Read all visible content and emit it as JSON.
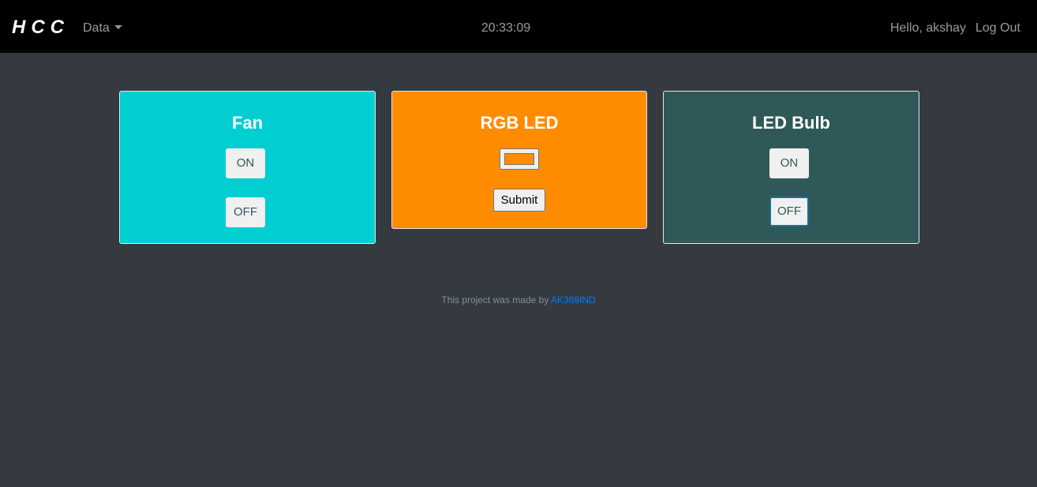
{
  "navbar": {
    "brand": "HCC",
    "data_menu_label": "Data",
    "clock": "20:33:09",
    "greeting": "Hello, akshay",
    "logout_label": "Log Out"
  },
  "cards": {
    "fan": {
      "title": "Fan",
      "on_label": "ON",
      "off_label": "OFF",
      "background": "#00ced1"
    },
    "rgb_led": {
      "title": "RGB LED",
      "color_value": "#ff8c00",
      "submit_label": "Submit",
      "background": "#ff8c00"
    },
    "led_bulb": {
      "title": "LED Bulb",
      "on_label": "ON",
      "off_label": "OFF",
      "background": "#2f5959"
    }
  },
  "footer": {
    "text": "This project was made by ",
    "link_text": "AK369IND",
    "link_color": "#007bff"
  },
  "colors": {
    "page_background": "#343a40",
    "navbar_background": "#000000"
  }
}
